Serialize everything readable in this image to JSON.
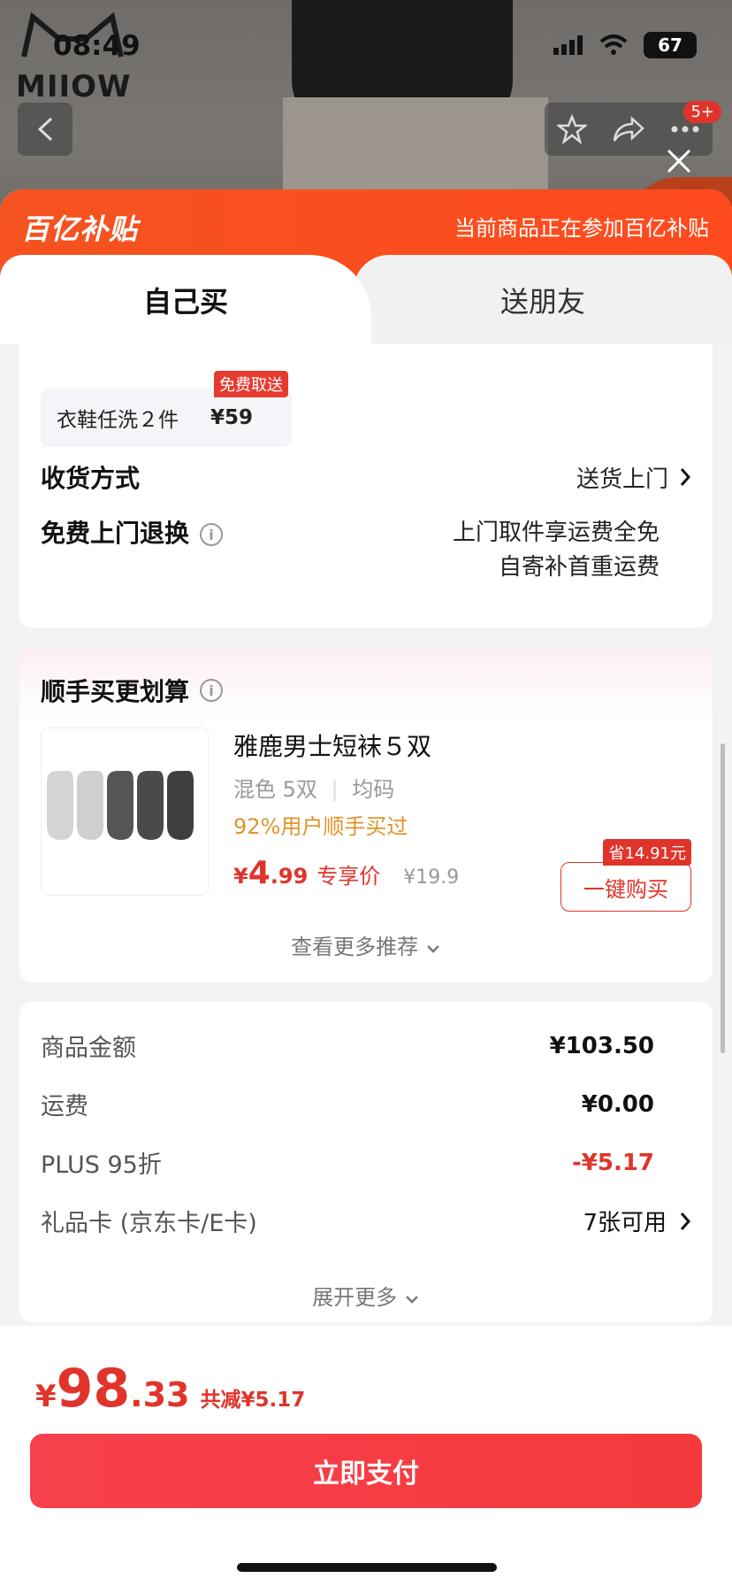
{
  "status": {
    "time": "08:49",
    "battery": "67"
  },
  "brand": {
    "name": "MIIOW"
  },
  "nav": {
    "badge": "5+"
  },
  "subsidy": {
    "logo": "百亿补贴",
    "note": "当前商品正在参加百亿补贴"
  },
  "tabs": [
    {
      "label": "自己买",
      "selected": true
    },
    {
      "label": "送朋友",
      "selected": false
    }
  ],
  "delivery": {
    "wash": {
      "label": "衣鞋任洗２件",
      "price": "¥59",
      "tag": "免费取送"
    },
    "shipping_label": "收货方式",
    "shipping_value": "送货上门",
    "return_label": "免费上门退换",
    "return_line1": "上门取件享运费全免",
    "return_line2": "自寄补首重运费"
  },
  "bundle": {
    "title": "顺手买更划算",
    "product": {
      "name": "雅鹿男士短袜５双",
      "spec_color": "混色 5双",
      "spec_size": "均码",
      "buyers": "92%用户顺手买过",
      "price_currency": "¥",
      "price_int": "4",
      "price_dec": ".99",
      "price_label": "专享价",
      "original_price": "¥19.9",
      "save_tag": "省14.91元",
      "buy_label": "一键购买"
    },
    "more_label": "查看更多推荐"
  },
  "amounts": {
    "rows": [
      {
        "label": "商品金额",
        "value": "¥103.50"
      },
      {
        "label": "运费",
        "value": "¥0.00"
      },
      {
        "label": "PLUS 95折",
        "value": "-¥5.17"
      },
      {
        "label": "礼品卡 (京东卡/E卡)",
        "value": "7张可用"
      }
    ],
    "more_label": "展开更多"
  },
  "footer": {
    "currency": "¥",
    "total_int": "98",
    "total_dec": ".33",
    "saved": "共减¥5.17",
    "pay_label": "立即支付"
  },
  "colors": {
    "accent": "#e0342b",
    "subsidy": "#f4531f"
  }
}
